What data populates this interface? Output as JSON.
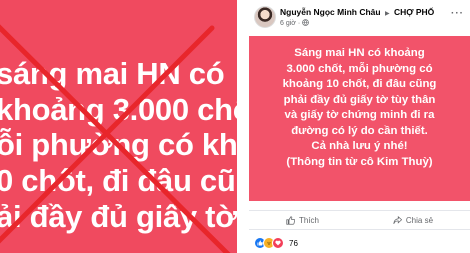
{
  "left_image": {
    "lines": [
      "sáng mai HN có",
      "khoảng 3.000 chốt,",
      "ỗi phường có khoả",
      "0 chốt, đi đâu cũng",
      "ải đầy đủ giấy tờ"
    ],
    "colors": {
      "background": "#f04a5f",
      "cross": "#e8262b",
      "text": "#ffffff"
    },
    "overlay_icon": "red-x-icon"
  },
  "post": {
    "author": "Nguyễn Ngọc Minh Châu",
    "group": "CHỢ PHỐ",
    "time": "6 giờ",
    "audience_icon": "globe-icon",
    "more_icon": "more-options-icon",
    "body_lines": [
      "Sáng mai HN có khoảng",
      "3.000 chốt, mỗi phường có",
      "khoảng 10 chốt, đi đâu cũng",
      "phải đầy đủ giấy tờ tùy thân",
      "và giấy tờ chứng minh đi ra",
      "đường có lý do cần thiết.",
      "Cả nhà lưu ý nhé!",
      "(Thông tin từ cô Kim Thuỳ)"
    ],
    "colors": {
      "background": "#f2536a",
      "text": "#ffffff",
      "meta": "#65676b"
    },
    "actions": {
      "like": "Thích",
      "share": "Chia sẻ"
    },
    "reaction_count": "76",
    "reaction_icons": [
      "like-reaction-icon",
      "haha-reaction-icon",
      "love-reaction-icon"
    ]
  }
}
